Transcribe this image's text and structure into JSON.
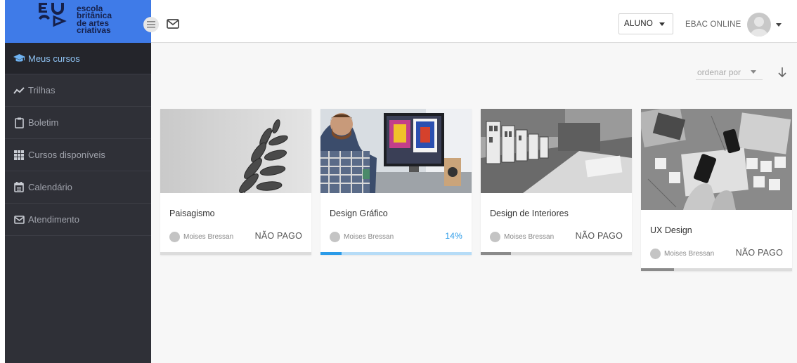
{
  "brand": {
    "logo_lines": [
      "escola",
      "britânica",
      "de artes",
      "criativas"
    ],
    "color": "#3f7be8"
  },
  "sidebar": {
    "items": [
      {
        "label": "Meus cursos",
        "icon": "graduation-cap-icon",
        "active": true
      },
      {
        "label": "Trilhas",
        "icon": "trend-line-icon",
        "active": false
      },
      {
        "label": "Boletim",
        "icon": "clipboard-icon",
        "active": false
      },
      {
        "label": "Cursos disponíveis",
        "icon": "grid-icon",
        "active": false
      },
      {
        "label": "Calendário",
        "icon": "calendar-icon",
        "active": false
      },
      {
        "label": "Atendimento",
        "icon": "mail-icon",
        "active": false
      }
    ]
  },
  "header": {
    "role": "ALUNO",
    "user_name": "EBAC ONLINE"
  },
  "sort": {
    "label": "ordenar por"
  },
  "courses": [
    {
      "title": "Paisagismo",
      "author": "Moises Bressan",
      "status": "NÃO PAGO",
      "progress": 0
    },
    {
      "title": "Design Gráfico",
      "author": "Moises Bressan",
      "status": "14%",
      "progress": 14
    },
    {
      "title": "Design de Interiores",
      "author": "Moises Bressan",
      "status": "NÃO PAGO",
      "progress": 20
    },
    {
      "title": "UX Design",
      "author": "Moises Bressan",
      "status": "NÃO PAGO",
      "progress": 22
    }
  ]
}
